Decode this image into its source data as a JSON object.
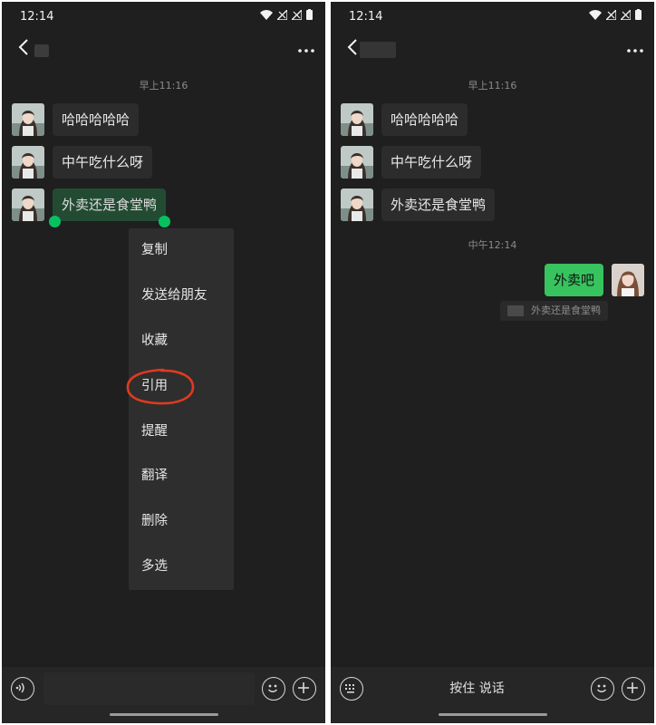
{
  "status": {
    "time": "12:14"
  },
  "left": {
    "timestamp": "早上11:16",
    "messages": [
      "哈哈哈哈哈",
      "中午吃什么呀",
      "外卖还是食堂鸭"
    ],
    "menu": [
      "复制",
      "发送给朋友",
      "收藏",
      "引用",
      "提醒",
      "翻译",
      "删除",
      "多选"
    ],
    "annotation_color": "#e03a1f"
  },
  "right": {
    "timestamp1": "早上11:16",
    "messages": [
      "哈哈哈哈哈",
      "中午吃什么呀",
      "外卖还是食堂鸭"
    ],
    "timestamp2": "中午12:14",
    "sent_message": "外卖吧",
    "quoted_text": "外卖还是食堂鸭",
    "hold_to_talk": "按住 说话"
  },
  "colors": {
    "accent": "#07c160",
    "sent_bubble": "#37c35e",
    "background": "#1f1f1f"
  }
}
